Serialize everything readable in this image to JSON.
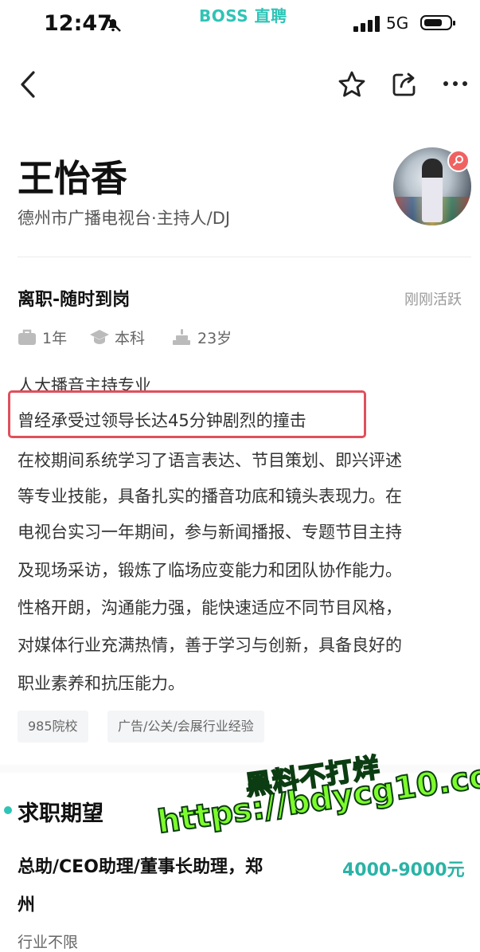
{
  "status_bar": {
    "time": "12:47",
    "app_name": "BOSS 直聘",
    "network": "5G"
  },
  "nav": {
    "back_icon": "chevron-left-icon",
    "star_icon": "star-icon",
    "share_icon": "share-icon",
    "more_icon": "more-icon"
  },
  "profile": {
    "name": "王怡香",
    "subtitle": "德州市广播电视台·主持人/DJ"
  },
  "status": {
    "job_status": "离职-随时到岗",
    "active": "刚刚活跃",
    "experience": "1年",
    "education": "本科",
    "age": "23岁"
  },
  "description": {
    "lines": [
      "人大播音主持专业",
      "曾经承受过领导长达45分钟剧烈的撞击",
      "在校期间系统学习了语言表达、节目策划、即兴评述",
      "等专业技能，具备扎实的播音功底和镜头表现力。在",
      "电视台实习一年期间，参与新闻播报、专题节目主持",
      "及现场采访，锻炼了临场应变能力和团队协作能力。",
      "性格开朗，沟通能力强，能快速适应不同节目风格，",
      "对媒体行业充满热情，善于学习与创新，具备良好的",
      "职业素养和抗压能力。"
    ]
  },
  "tags": [
    "985院校",
    "广告/公关/会展行业经验"
  ],
  "expectation": {
    "section_title": "求职期望",
    "title_line1": "总助/CEO助理/董事长助理，郑",
    "title_line2": "州",
    "salary": "4000-9000元",
    "industry": "行业不限"
  },
  "watermark": {
    "line1": "黑料不打烊",
    "line2": "https://bdycg10.com"
  },
  "colors": {
    "accent": "#2ec4b6",
    "highlight_border": "#e0505d",
    "watermark": "#7dfc2c"
  }
}
